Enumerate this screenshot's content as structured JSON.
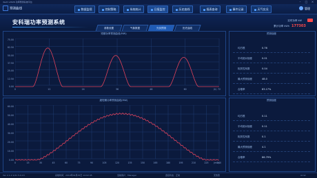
{
  "titlebar": {
    "text": "dev0 v2626 功率预测系统平台"
  },
  "brand": {
    "title": "预测曲线"
  },
  "nav": [
    {
      "label": "数据监视"
    },
    {
      "label": "控制策略"
    },
    {
      "label": "系统统计"
    },
    {
      "label": "日报监控"
    },
    {
      "label": "历史曲线"
    },
    {
      "label": "报表查询"
    },
    {
      "label": "事件记录"
    },
    {
      "label": "天气实况"
    }
  ],
  "user": {
    "label": "管理"
  },
  "system": {
    "title": "安科瑞功率预测系统"
  },
  "tabs": [
    {
      "label": "参数设置"
    },
    {
      "label": "气象数据"
    },
    {
      "label": "光伏预测"
    },
    {
      "label": "历史曲线"
    }
  ],
  "power": {
    "realtime_label": "实时功率 kW",
    "total_label": "累计功率 kWh",
    "total_value": "177303"
  },
  "chart_top": {
    "title": "短期功率预测曲线(MW)",
    "yticks": [
      "75.00",
      "62.50",
      "50.00",
      "37.50",
      "25.00",
      "12.50",
      "0.00"
    ],
    "xticks": [
      "0",
      "12",
      "24",
      "36",
      "48",
      "60",
      "72"
    ],
    "xunit": "(h)"
  },
  "chart_bottom": {
    "title": "超短期功率预测曲线(MW)",
    "yticks": [
      "60.00",
      "50.00",
      "40.00",
      "30.00",
      "20.00",
      "10.00",
      "0.00"
    ],
    "xticks": [
      "0",
      "15",
      "30",
      "45",
      "60",
      "75",
      "90",
      "105",
      "120",
      "135",
      "150",
      "165",
      "180",
      "195",
      "210",
      "225",
      "240"
    ],
    "xunit": "(min)"
  },
  "stats_top": {
    "title": "预测误差",
    "rows": [
      {
        "label": "均方根",
        "value": "0.76"
      },
      {
        "label": "平均绝对误差",
        "value": "0.01"
      },
      {
        "label": "相关性系数",
        "value": "0.04"
      },
      {
        "label": "最大预测误差",
        "value": "48.0"
      },
      {
        "label": "合格率",
        "value": "83.17%"
      }
    ]
  },
  "stats_bottom": {
    "title": "预测误差",
    "rows": [
      {
        "label": "均方根",
        "value": "0.11"
      },
      {
        "label": "平均绝对误差",
        "value": "0.11"
      },
      {
        "label": "相关性系数",
        "value": "0.1"
      },
      {
        "label": "最大预测误差",
        "value": "4.1"
      },
      {
        "label": "合格率",
        "value": "86.79%"
      }
    ]
  },
  "statusbar": {
    "version": "Ver 2.1.0 1/21 5.0.13",
    "time": "系统时间：2019年09月25日 14:02:45",
    "user": "当前用户：Manager",
    "status": "连接状态：正常",
    "alarm": "无告警",
    "right": "Acrel"
  },
  "colors": {
    "curve": "#e0425b",
    "accent": "#2f7ff0",
    "power": "#ff4a4a"
  }
}
